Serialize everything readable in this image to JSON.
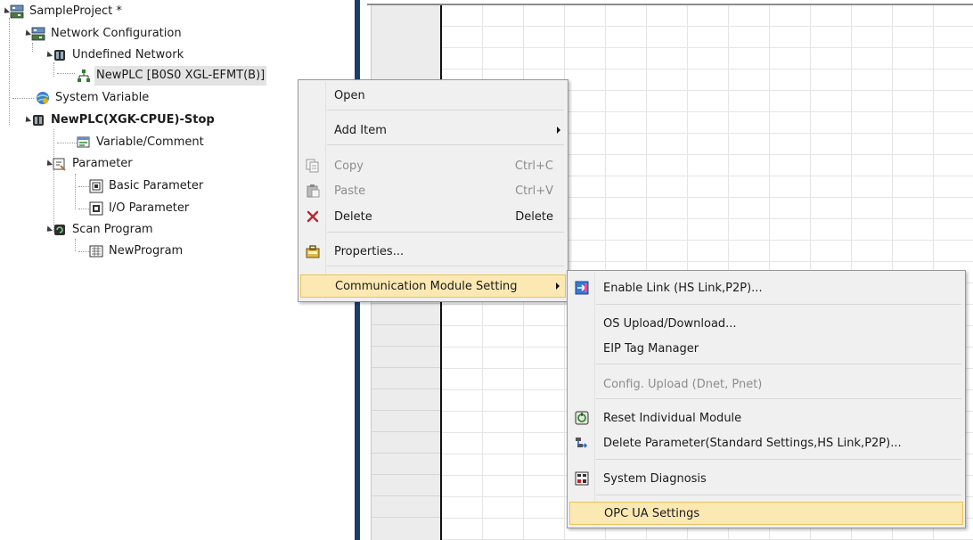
{
  "tree": {
    "nodes": [
      {
        "label": "SampleProject *",
        "icon": "project-icon",
        "bold": false
      },
      {
        "label": "Network Configuration",
        "icon": "network-config-icon",
        "bold": false
      },
      {
        "label": "Undefined Network",
        "icon": "network-icon",
        "bold": false
      },
      {
        "label": "NewPLC [B0S0 XGL-EFMT(B)]",
        "icon": "plc-module-icon",
        "bold": false
      },
      {
        "label": "System Variable",
        "icon": "globe-variable-icon",
        "bold": false
      },
      {
        "label": "NewPLC(XGK-CPUE)-Stop",
        "icon": "cpu-icon",
        "bold": true
      },
      {
        "label": "Variable/Comment",
        "icon": "variable-icon",
        "bold": false
      },
      {
        "label": "Parameter",
        "icon": "parameter-icon",
        "bold": false
      },
      {
        "label": "Basic Parameter",
        "icon": "basic-parameter-icon",
        "bold": false
      },
      {
        "label": "I/O Parameter",
        "icon": "io-parameter-icon",
        "bold": false
      },
      {
        "label": "Scan Program",
        "icon": "scan-program-icon",
        "bold": false
      },
      {
        "label": "NewProgram",
        "icon": "program-icon",
        "bold": false
      }
    ]
  },
  "context_menu": {
    "items": [
      {
        "label": "Open",
        "shortcut": "",
        "icon": "",
        "disabled": false
      },
      {
        "label": "Add Item",
        "shortcut": "",
        "icon": "",
        "disabled": false,
        "submenu": true
      },
      {
        "label": "Copy",
        "shortcut": "Ctrl+C",
        "icon": "copy-icon",
        "disabled": true
      },
      {
        "label": "Paste",
        "shortcut": "Ctrl+V",
        "icon": "paste-icon",
        "disabled": true
      },
      {
        "label": "Delete",
        "shortcut": "Delete",
        "icon": "delete-icon",
        "disabled": false
      },
      {
        "label": "Properties...",
        "shortcut": "",
        "icon": "properties-icon",
        "disabled": false
      },
      {
        "label": "Communication Module Setting",
        "shortcut": "",
        "icon": "",
        "disabled": false,
        "submenu": true,
        "highlighted": true
      }
    ]
  },
  "submenu": {
    "items": [
      {
        "label": "Enable Link (HS Link,P2P)...",
        "icon": "enable-link-icon",
        "disabled": false
      },
      {
        "label": "OS Upload/Download...",
        "icon": "",
        "disabled": false
      },
      {
        "label": "EIP Tag Manager",
        "icon": "",
        "disabled": false
      },
      {
        "label": "Config. Upload (Dnet, Pnet)",
        "icon": "",
        "disabled": true
      },
      {
        "label": "Reset Individual Module",
        "icon": "reset-module-icon",
        "disabled": false
      },
      {
        "label": "Delete Parameter(Standard Settings,HS Link,P2P)...",
        "icon": "delete-parameter-icon",
        "disabled": false
      },
      {
        "label": "System Diagnosis",
        "icon": "system-diagnosis-icon",
        "disabled": false
      },
      {
        "label": "OPC UA Settings",
        "icon": "",
        "disabled": false,
        "highlighted": true
      }
    ]
  },
  "colors": {
    "menu_highlight": "#fce8b3",
    "splitter": "#1f3b6e",
    "delete_red": "#c0232b"
  }
}
